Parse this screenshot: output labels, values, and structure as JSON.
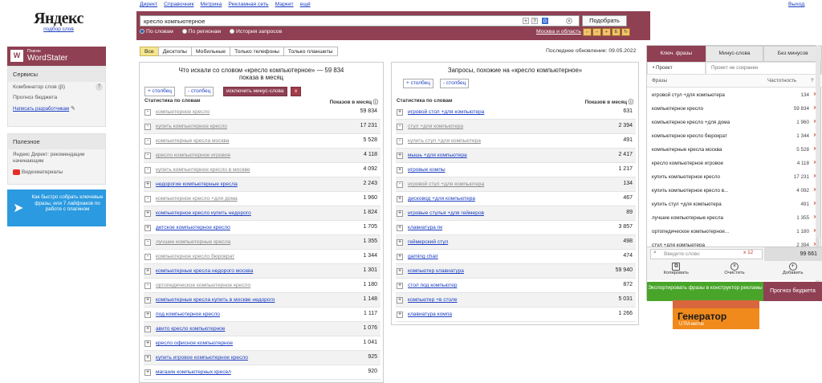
{
  "logo": {
    "brand": "Яндекс",
    "sub": "подбор слов"
  },
  "topnav": [
    "Директ",
    "Справочник",
    "Метрика",
    "Рекламная сеть",
    "Маркет",
    "ещё"
  ],
  "exit": "Выход",
  "search": {
    "value": "кресло компьютерное",
    "button": "Подобрать",
    "radios": [
      "По словам",
      "По регионам",
      "История запросов"
    ],
    "region": "Москва и область"
  },
  "filters": [
    "Все",
    "Десктопы",
    "Мобильные",
    "Только телефоны",
    "Только планшеты"
  ],
  "updated": "Последнее обновление: 09.05.2022",
  "plugin": {
    "small": "Плагин",
    "name": "WordStater"
  },
  "services": {
    "title": "Сервисы",
    "items": [
      "Комбинатор слов (β)",
      "Прогноз бюджета"
    ],
    "link": "Написать разработчикам"
  },
  "useful": {
    "title": "Полезное",
    "items": [
      "Яндекс Директ: рекомендации начинающим",
      "Видеоматериалы"
    ]
  },
  "telegram": "Как быстро собрать ключевые фразы, или 7 лайфхаков по работе с плагином",
  "left": {
    "title": "Что искали со словом «кресло компьютерное» — 59 834 показа в месяц",
    "add": "+ столбец",
    "remove": "- столбец",
    "exclude": "исключить минус-слова",
    "x": "x",
    "col1": "Статистика по словам",
    "col2": "Показов в месяц",
    "rows": [
      {
        "s": "-",
        "p": "компьютерное кресло",
        "c": "59 834",
        "used": true
      },
      {
        "s": "-",
        "p": "купить компьютерное кресло",
        "c": "17 231",
        "used": true
      },
      {
        "s": "-",
        "p": "компьютерные кресла москва",
        "c": "5 528",
        "used": true
      },
      {
        "s": "-",
        "p": "кресло компьютерное игровое",
        "c": "4 118",
        "used": true
      },
      {
        "s": "-",
        "p": "купить компьютерное кресло в москве",
        "c": "4 092",
        "used": true
      },
      {
        "s": "+",
        "p": "недорогие компьютерные кресла",
        "c": "2 243",
        "used": false
      },
      {
        "s": "-",
        "p": "компьютерное кресло +для дома",
        "c": "1 960",
        "used": true
      },
      {
        "s": "+",
        "p": "компьютерное кресло купить недорого",
        "c": "1 824",
        "used": false
      },
      {
        "s": "+",
        "p": "детское компьютерное кресло",
        "c": "1 705",
        "used": false
      },
      {
        "s": "-",
        "p": "лучшие компьютерные кресла",
        "c": "1 355",
        "used": true
      },
      {
        "s": "-",
        "p": "компьютерное кресло бюрократ",
        "c": "1 344",
        "used": true
      },
      {
        "s": "+",
        "p": "компьютерные кресла недорого москва",
        "c": "1 301",
        "used": false
      },
      {
        "s": "-",
        "p": "ортопедическое компьютерное кресло",
        "c": "1 180",
        "used": true
      },
      {
        "s": "+",
        "p": "компьютерные кресла купить в москве недорого",
        "c": "1 148",
        "used": false
      },
      {
        "s": "+",
        "p": "под компьютерное кресло",
        "c": "1 117",
        "used": false
      },
      {
        "s": "+",
        "p": "авито кресло компьютерное",
        "c": "1 076",
        "used": false
      },
      {
        "s": "+",
        "p": "кресло офисное компьютерное",
        "c": "1 041",
        "used": false
      },
      {
        "s": "+",
        "p": "купить игровое компьютерное кресло",
        "c": "925",
        "used": false
      },
      {
        "s": "+",
        "p": "магазин компьютерных кресел",
        "c": "920",
        "used": false
      }
    ]
  },
  "right": {
    "title": "Запросы, похожие на «кресло компьютерное»",
    "add": "+ столбец",
    "remove": "- столбец",
    "col1": "Статистика по словам",
    "col2": "Показов в месяц",
    "rows": [
      {
        "s": "+",
        "p": "игровой стол +для компьютера",
        "c": "631",
        "used": false
      },
      {
        "s": "-",
        "p": "стул +для компьютера",
        "c": "2 394",
        "used": true
      },
      {
        "s": "-",
        "p": "купить стул +для компьютера",
        "c": "491",
        "used": true
      },
      {
        "s": "+",
        "p": "мышь +для компьютера",
        "c": "2 417",
        "used": false
      },
      {
        "s": "+",
        "p": "игровые компы",
        "c": "1 217",
        "used": false
      },
      {
        "s": "-",
        "p": "игровой стул +для компьютера",
        "c": "134",
        "used": true
      },
      {
        "s": "+",
        "p": "диcковод +для компьютера",
        "c": "467",
        "used": false
      },
      {
        "s": "+",
        "p": "игровые стулья +для геймеров",
        "c": "89",
        "used": false
      },
      {
        "s": "+",
        "p": "клавиатура пк",
        "c": "3 857",
        "used": false
      },
      {
        "s": "+",
        "p": "геймерский стул",
        "c": "498",
        "used": false
      },
      {
        "s": "+",
        "p": "gaming chair",
        "c": "474",
        "used": false
      },
      {
        "s": "+",
        "p": "компьютер клавиатура",
        "c": "59 940",
        "used": false
      },
      {
        "s": "+",
        "p": "стол под компьютер",
        "c": "872",
        "used": false
      },
      {
        "s": "+",
        "p": "компьютер +в столе",
        "c": "5 031",
        "used": false
      },
      {
        "s": "+",
        "p": "клавиатура компа",
        "c": "1 266",
        "used": false
      }
    ]
  },
  "plug": {
    "tabs": [
      "Ключ. фразы",
      "Минус-слова",
      "Без минусов"
    ],
    "project": "• Проект",
    "project_state": "Проект не сохранен",
    "col1": "Фразы",
    "col2": "Частотность",
    "items": [
      {
        "p": "игровой стул +для компьютера",
        "c": "134"
      },
      {
        "p": "компьютерное кресло",
        "c": "59 834"
      },
      {
        "p": "компьютерное кресло +для дома",
        "c": "1 960"
      },
      {
        "p": "компьютерное кресло бюрократ",
        "c": "1 344"
      },
      {
        "p": "компьютерные кресла москва",
        "c": "5 528"
      },
      {
        "p": "кресло компьютерное игровое",
        "c": "4 118"
      },
      {
        "p": "купить компьютерное кресло",
        "c": "17 231"
      },
      {
        "p": "купить компьютерное кресло в...",
        "c": "4 092"
      },
      {
        "p": "купить стул +для компьютера",
        "c": "491"
      },
      {
        "p": "лучшие компьютерные кресла",
        "c": "1 355"
      },
      {
        "p": "ортопедическое компьютерное...",
        "c": "1 180"
      },
      {
        "p": "стул +для компьютера",
        "c": "2 394"
      }
    ],
    "input_ph": "Введите слово",
    "count": "12",
    "total": "99 661",
    "copy": "Копировать",
    "clear": "Очистить",
    "add": "Добавить",
    "export": "Экспортировать фразы в конструктор рекламы",
    "budget": "Прогноз бюджета"
  },
  "banner": {
    "title": "Генератор",
    "sub": "UTM-меток"
  }
}
